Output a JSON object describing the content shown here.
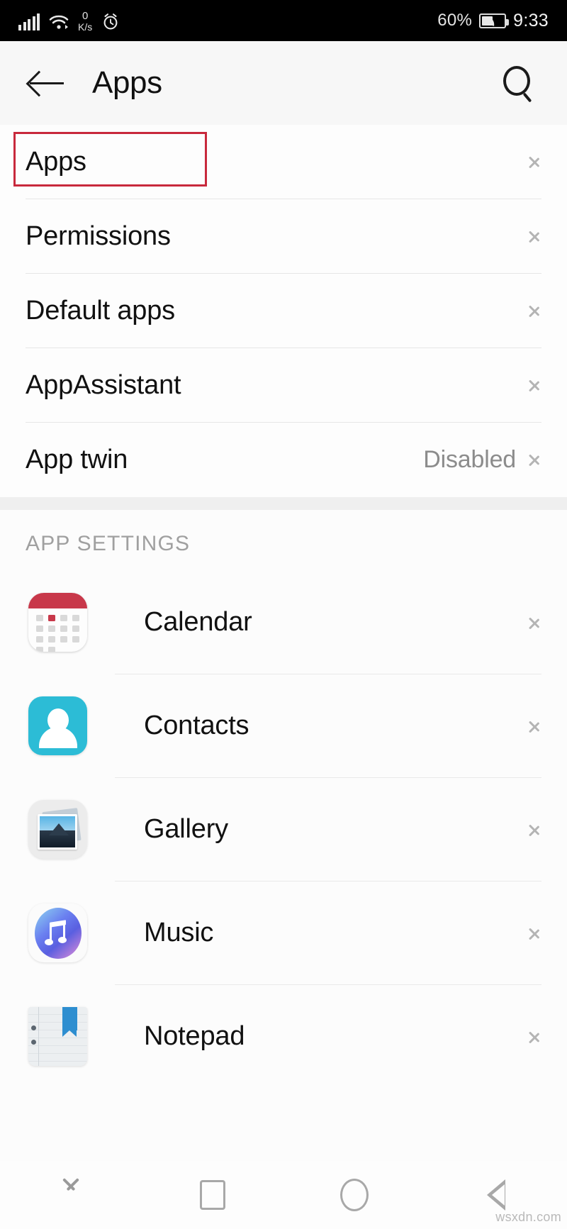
{
  "status_bar": {
    "network_speed_value": "0",
    "network_speed_unit": "K/s",
    "battery_percent": "60%",
    "time": "9:33",
    "icons": [
      "signal-bars-icon",
      "wifi-icon",
      "alarm-clock-icon",
      "battery-icon"
    ]
  },
  "app_bar": {
    "title": "Apps",
    "back_icon": "back-arrow-icon",
    "search_icon": "search-icon"
  },
  "settings_group": {
    "items": [
      {
        "label": "Apps",
        "value": "",
        "highlighted": true
      },
      {
        "label": "Permissions",
        "value": "",
        "highlighted": false
      },
      {
        "label": "Default apps",
        "value": "",
        "highlighted": false
      },
      {
        "label": "AppAssistant",
        "value": "",
        "highlighted": false
      },
      {
        "label": "App twin",
        "value": "Disabled",
        "highlighted": false
      }
    ]
  },
  "app_settings_section": {
    "title": "APP SETTINGS",
    "items": [
      {
        "label": "Calendar",
        "icon": "calendar-app-icon"
      },
      {
        "label": "Contacts",
        "icon": "contacts-app-icon"
      },
      {
        "label": "Gallery",
        "icon": "gallery-app-icon"
      },
      {
        "label": "Music",
        "icon": "music-app-icon"
      },
      {
        "label": "Notepad",
        "icon": "notepad-app-icon"
      }
    ]
  },
  "nav_bar": {
    "items": [
      "chevron-down-icon",
      "recents-square-icon",
      "home-circle-icon",
      "back-triangle-icon"
    ]
  },
  "watermark": "wsxdn.com",
  "colors": {
    "annotation": "#c8293c",
    "status_bar_bg": "#000000",
    "app_bar_bg": "#f7f7f7",
    "calendar_red": "#c8384a",
    "contacts_cyan": "#2cbcd6",
    "notepad_blue": "#2e8ed0"
  }
}
